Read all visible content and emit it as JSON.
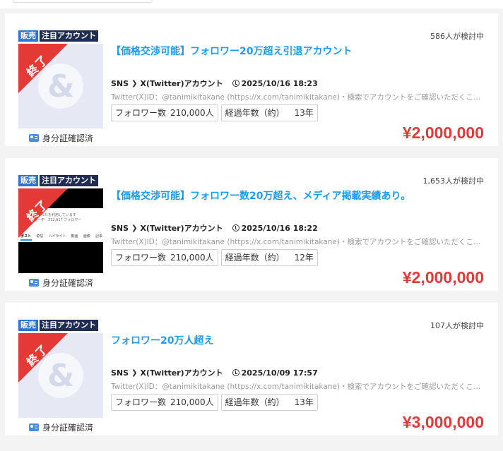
{
  "listings": [
    {
      "badge_sale": "販売",
      "badge_featured": "注目アカウント",
      "ribbon": "終了",
      "verified": "身分証確認済",
      "viewers": "586人が検討中",
      "title": "【価格交渉可能】フォロワー20万超え引退アカウント",
      "category": "SNS",
      "subcategory": "X(Twitter)アカウント",
      "date": "2025/10/16 18:23",
      "description": "Twitter(X)ID：@tanimikitakane (https://x.com/tanimikitakane)・検索でアカウントをご確認いただくことで、アカウントの状態等をご確認いただけます",
      "followers_label": "フォロワー数",
      "followers_value": "210,000人",
      "years_label": "経過年数（約）",
      "years_value": "13年",
      "price": "¥2,000,000",
      "thumb_logo": "&"
    },
    {
      "badge_sale": "販売",
      "badge_featured": "注目アカウント",
      "ribbon": "終了",
      "verified": "身分証確認済",
      "viewers": "1,653人が検討中",
      "title": "【価格交渉可能】フォロワー数20万超え、メディア掲載実績あり。",
      "category": "SNS",
      "subcategory": "X(Twitter)アカウント",
      "date": "2025/10/16 18:22",
      "description": "Twitter(X)ID：@tanimikitakane (https://x.com/tanimikitakane)・検索でアカウントをご確認いただくことで、アカウントの状態等をご確認いただけます",
      "followers_label": "フォロワー数",
      "followers_value": "210,000人",
      "years_label": "経過年数（約）",
      "years_value": "12年",
      "price": "¥2,000,000",
      "shot_line1": "・人があなたを利用しています",
      "shot_line2": "フォロー中　212,817 フォロワー",
      "shot_tabs": [
        "ポスト",
        "返信",
        "ハイライト",
        "動画",
        "画像",
        "記事"
      ]
    },
    {
      "badge_sale": "販売",
      "badge_featured": "注目アカウント",
      "ribbon": "終了",
      "verified": "身分証確認済",
      "viewers": "107人が検討中",
      "title": "フォロワー20万人超え",
      "category": "SNS",
      "subcategory": "X(Twitter)アカウント",
      "date": "2025/10/09 17:57",
      "description": "Twitter(X)ID：@tanimikitakane (https://x.com/tanimikitakane)・検索でアカウントをご確認いただくことで、アカウントの状態等をご確認いただけます",
      "followers_label": "フォロワー数",
      "followers_value": "210,000人",
      "years_label": "経過年数（約）",
      "years_value": "13年",
      "price": "¥3,000,000",
      "thumb_logo": "&"
    }
  ],
  "colors": {
    "accent_link": "#1d9bf0",
    "price": "#e03a3a",
    "ribbon": "#e53935",
    "badge_sale": "#2f73d1",
    "badge_featured": "#1f2d52"
  }
}
